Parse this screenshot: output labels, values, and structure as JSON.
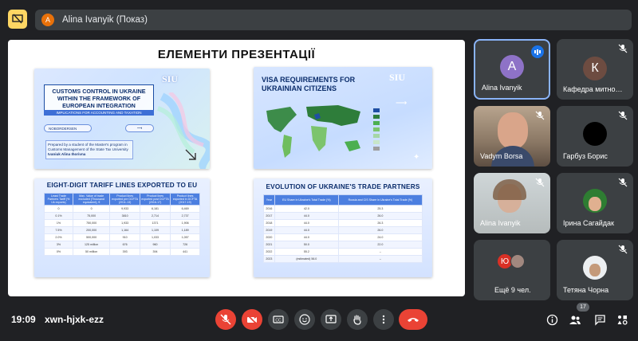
{
  "header": {
    "presenter_initial": "A",
    "presenter_label": "Alina Ivanyik (Показ)"
  },
  "slide": {
    "title": "ЕЛЕМЕНТИ ПРЕЗЕНТАЦІЇ",
    "thumb1": {
      "logo": "SIU",
      "title": "CUSTOMS CONTROL IN UKRAINE WITHIN THE FRAMEWORK OF EUROPEAN INTEGRATION",
      "subtitle": "IMPLICATIONS FOR ACCOUNTING AND TAXATION",
      "button": "NOBORDERSEN",
      "prepared": "Prepared by a student of the Master's program in Customs Management of the State Tax University",
      "author": "Ivaniuk Alina Ihorivna"
    },
    "thumb2": {
      "logo": "SIU",
      "title": "VISA REQUIREMENTS FOR UKRAINIAN CITIZENS"
    },
    "thumb3": {
      "title": "EIGHT-DIGIT TARIFF LINES EXPORTED TO EU",
      "headers": [
        "Least Trade Partners Tariff (% Uk exports)",
        "Max. Value of trade excluded (Thousand equivalent), €",
        "Product lines exported pre DCFTA (2011-13)",
        "Product lines exported post DCFTA (2016-17)",
        "Product lines exported in DCFTA (2017-19)"
      ],
      "rows": [
        [
          "0",
          "0",
          "9,933",
          "6,181",
          "6,469"
        ],
        [
          "0.1%",
          "75,000",
          "3810",
          "2,714",
          "2,737"
        ],
        [
          "1%",
          "750,000",
          "1,933",
          "1371",
          "1,906"
        ],
        [
          "7.5%",
          "200,000",
          "1,164",
          "1,109",
          "1,189"
        ],
        [
          "2.0%",
          "500,000",
          "910",
          "1,033",
          "1,057"
        ],
        [
          "3%",
          "125 million",
          "676",
          "960",
          "726"
        ],
        [
          "0%",
          "50 million",
          "393",
          "394",
          "441"
        ]
      ]
    },
    "thumb4": {
      "title": "EVOLUTION OF UKRAINE'S TRADE PARTNERS",
      "headers": [
        "Year",
        "EU Share in Ukraine's Total Trade (%)",
        "Russia and CIS Share in Ukraine's Total Trade (%)"
      ],
      "rows": [
        [
          "2016",
          "42.0",
          "25.3"
        ],
        [
          "2017",
          "44.0",
          "26.0"
        ],
        [
          "2018",
          "44.0",
          "26.3"
        ],
        [
          "2019",
          "44.0",
          "26.0"
        ],
        [
          "2020",
          "44.0",
          "24.0"
        ],
        [
          "2021",
          "50.0",
          "22.0"
        ],
        [
          "2022",
          "55.2",
          "–"
        ],
        [
          "2023",
          "(estimated) 56.0",
          "–"
        ]
      ]
    }
  },
  "participants": [
    {
      "name": "Alina Ivanyik",
      "initial": "A",
      "avatar_color": "#8e72c7",
      "speaking": true
    },
    {
      "name": "Кафедра митно…",
      "initial": "К",
      "avatar_color": "#6d4c41",
      "muted": true
    },
    {
      "name": "Vadym Borsa",
      "muted": true
    },
    {
      "name": "Гарбуз Борис",
      "muted": true
    },
    {
      "name": "Alina Ivanyik",
      "muted": true
    },
    {
      "name": "Ірина Сагайдак",
      "muted": true
    },
    {
      "name": "Ещё 9 чел.",
      "initial": "Ю",
      "avatar_color": "#d93025"
    },
    {
      "name": "Тетяна Чорна",
      "muted": true
    }
  ],
  "footer": {
    "time": "19:09",
    "meeting_code": "xwn-hjxk-ezz",
    "people_count": "17"
  }
}
